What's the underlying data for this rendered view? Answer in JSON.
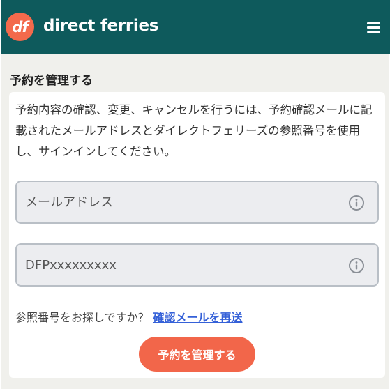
{
  "header": {
    "logo_text": "df",
    "brand_name": "direct ferries",
    "menu_icon": "hamburger-menu-icon"
  },
  "page": {
    "title": "予約を管理する",
    "intro": "予約内容の確認、変更、キャンセルを行うには、予約確認メールに記載されたメールアドレスとダイレクトフェリーズの参照番号を使用し、サインインしてください。"
  },
  "form": {
    "email_placeholder": "メールアドレス",
    "email_value": "",
    "reference_placeholder": "DFPxxxxxxxxx",
    "reference_value": "",
    "info_icon": "info-circle-icon"
  },
  "help": {
    "text": "参照番号をお探しですか？",
    "link": "確認メールを再送"
  },
  "submit_label": "予約を管理する",
  "colors": {
    "header_bg": "#0e5a5c",
    "brand_accent": "#f36a4c",
    "link": "#3561d8",
    "button": "#f2664a"
  }
}
